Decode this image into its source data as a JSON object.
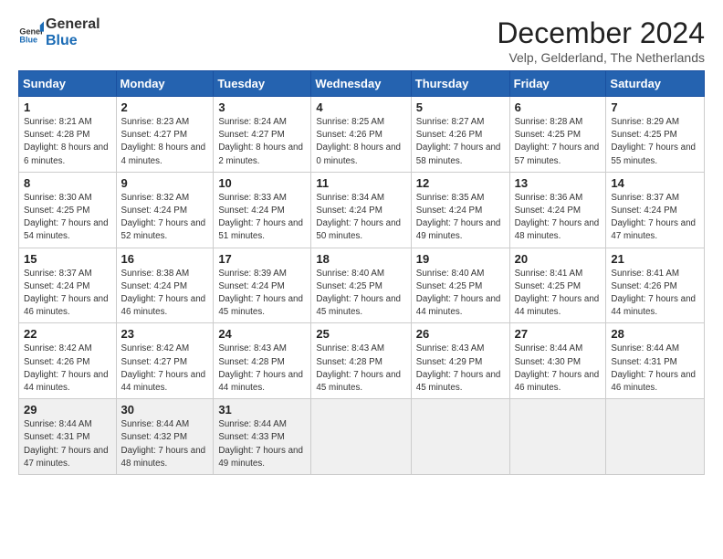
{
  "header": {
    "logo_general": "General",
    "logo_blue": "Blue",
    "month_title": "December 2024",
    "subtitle": "Velp, Gelderland, The Netherlands"
  },
  "days_of_week": [
    "Sunday",
    "Monday",
    "Tuesday",
    "Wednesday",
    "Thursday",
    "Friday",
    "Saturday"
  ],
  "weeks": [
    [
      {
        "day": "1",
        "sunrise": "8:21 AM",
        "sunset": "4:28 PM",
        "daylight": "8 hours and 6 minutes."
      },
      {
        "day": "2",
        "sunrise": "8:23 AM",
        "sunset": "4:27 PM",
        "daylight": "8 hours and 4 minutes."
      },
      {
        "day": "3",
        "sunrise": "8:24 AM",
        "sunset": "4:27 PM",
        "daylight": "8 hours and 2 minutes."
      },
      {
        "day": "4",
        "sunrise": "8:25 AM",
        "sunset": "4:26 PM",
        "daylight": "8 hours and 0 minutes."
      },
      {
        "day": "5",
        "sunrise": "8:27 AM",
        "sunset": "4:26 PM",
        "daylight": "7 hours and 58 minutes."
      },
      {
        "day": "6",
        "sunrise": "8:28 AM",
        "sunset": "4:25 PM",
        "daylight": "7 hours and 57 minutes."
      },
      {
        "day": "7",
        "sunrise": "8:29 AM",
        "sunset": "4:25 PM",
        "daylight": "7 hours and 55 minutes."
      }
    ],
    [
      {
        "day": "8",
        "sunrise": "8:30 AM",
        "sunset": "4:25 PM",
        "daylight": "7 hours and 54 minutes."
      },
      {
        "day": "9",
        "sunrise": "8:32 AM",
        "sunset": "4:24 PM",
        "daylight": "7 hours and 52 minutes."
      },
      {
        "day": "10",
        "sunrise": "8:33 AM",
        "sunset": "4:24 PM",
        "daylight": "7 hours and 51 minutes."
      },
      {
        "day": "11",
        "sunrise": "8:34 AM",
        "sunset": "4:24 PM",
        "daylight": "7 hours and 50 minutes."
      },
      {
        "day": "12",
        "sunrise": "8:35 AM",
        "sunset": "4:24 PM",
        "daylight": "7 hours and 49 minutes."
      },
      {
        "day": "13",
        "sunrise": "8:36 AM",
        "sunset": "4:24 PM",
        "daylight": "7 hours and 48 minutes."
      },
      {
        "day": "14",
        "sunrise": "8:37 AM",
        "sunset": "4:24 PM",
        "daylight": "7 hours and 47 minutes."
      }
    ],
    [
      {
        "day": "15",
        "sunrise": "8:37 AM",
        "sunset": "4:24 PM",
        "daylight": "7 hours and 46 minutes."
      },
      {
        "day": "16",
        "sunrise": "8:38 AM",
        "sunset": "4:24 PM",
        "daylight": "7 hours and 46 minutes."
      },
      {
        "day": "17",
        "sunrise": "8:39 AM",
        "sunset": "4:24 PM",
        "daylight": "7 hours and 45 minutes."
      },
      {
        "day": "18",
        "sunrise": "8:40 AM",
        "sunset": "4:25 PM",
        "daylight": "7 hours and 45 minutes."
      },
      {
        "day": "19",
        "sunrise": "8:40 AM",
        "sunset": "4:25 PM",
        "daylight": "7 hours and 44 minutes."
      },
      {
        "day": "20",
        "sunrise": "8:41 AM",
        "sunset": "4:25 PM",
        "daylight": "7 hours and 44 minutes."
      },
      {
        "day": "21",
        "sunrise": "8:41 AM",
        "sunset": "4:26 PM",
        "daylight": "7 hours and 44 minutes."
      }
    ],
    [
      {
        "day": "22",
        "sunrise": "8:42 AM",
        "sunset": "4:26 PM",
        "daylight": "7 hours and 44 minutes."
      },
      {
        "day": "23",
        "sunrise": "8:42 AM",
        "sunset": "4:27 PM",
        "daylight": "7 hours and 44 minutes."
      },
      {
        "day": "24",
        "sunrise": "8:43 AM",
        "sunset": "4:28 PM",
        "daylight": "7 hours and 44 minutes."
      },
      {
        "day": "25",
        "sunrise": "8:43 AM",
        "sunset": "4:28 PM",
        "daylight": "7 hours and 45 minutes."
      },
      {
        "day": "26",
        "sunrise": "8:43 AM",
        "sunset": "4:29 PM",
        "daylight": "7 hours and 45 minutes."
      },
      {
        "day": "27",
        "sunrise": "8:44 AM",
        "sunset": "4:30 PM",
        "daylight": "7 hours and 46 minutes."
      },
      {
        "day": "28",
        "sunrise": "8:44 AM",
        "sunset": "4:31 PM",
        "daylight": "7 hours and 46 minutes."
      }
    ],
    [
      {
        "day": "29",
        "sunrise": "8:44 AM",
        "sunset": "4:31 PM",
        "daylight": "7 hours and 47 minutes."
      },
      {
        "day": "30",
        "sunrise": "8:44 AM",
        "sunset": "4:32 PM",
        "daylight": "7 hours and 48 minutes."
      },
      {
        "day": "31",
        "sunrise": "8:44 AM",
        "sunset": "4:33 PM",
        "daylight": "7 hours and 49 minutes."
      },
      null,
      null,
      null,
      null
    ]
  ],
  "labels": {
    "sunrise": "Sunrise:",
    "sunset": "Sunset:",
    "daylight": "Daylight:"
  }
}
